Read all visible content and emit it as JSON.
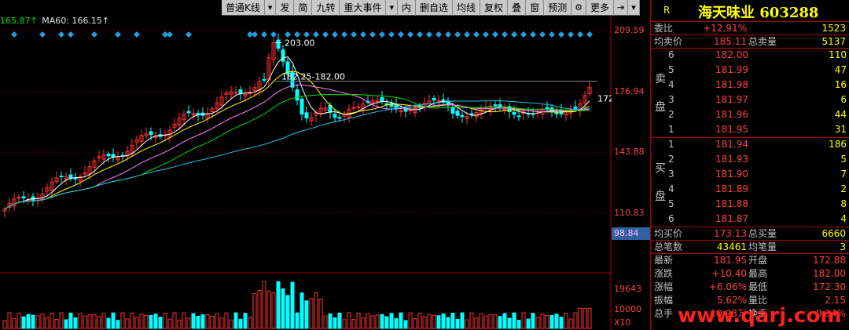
{
  "toolbar": {
    "items": [
      "普通K线",
      "发",
      "简",
      "九转",
      "重大事件",
      "内",
      "删自选",
      "均线",
      "复权",
      "叠",
      "窗",
      "预测",
      "更多"
    ],
    "icons": [
      "dropdown-icon",
      "dropdown-icon",
      "settings-icon",
      "dock-icon",
      "dropdown-icon"
    ]
  },
  "ma_legend": {
    "ma_prev": "165.87↑",
    "ma60": "MA60: 166.15↑"
  },
  "price_axis": {
    "labels": [
      "209.59",
      "176.94",
      "143.88",
      "110.83"
    ],
    "current_low": "98.84"
  },
  "annotations": {
    "high": "203.00",
    "range": "182.25-182.00",
    "right_price": "172"
  },
  "volume_axis": {
    "labels": [
      "19643",
      "10000"
    ],
    "unit": "X10"
  },
  "stock": {
    "r_label": "R",
    "title": "海天味业 603288"
  },
  "summary_top": {
    "weibi_label": "委比",
    "weibi_val": "+12.91%",
    "weibi_num": "1523",
    "avg_sell_label": "均卖价",
    "avg_sell_val": "185.11",
    "total_sell_label": "总卖量",
    "total_sell_val": "5137"
  },
  "sell_side": {
    "label": [
      "卖",
      "盘"
    ],
    "levels": [
      {
        "lvl": "6",
        "price": "182.00",
        "vol": "110"
      },
      {
        "lvl": "5",
        "price": "181.99",
        "vol": "47"
      },
      {
        "lvl": "4",
        "price": "181.98",
        "vol": "16"
      },
      {
        "lvl": "3",
        "price": "181.97",
        "vol": "6"
      },
      {
        "lvl": "2",
        "price": "181.96",
        "vol": "44"
      },
      {
        "lvl": "1",
        "price": "181.95",
        "vol": "31"
      }
    ]
  },
  "buy_side": {
    "label": [
      "买",
      "盘"
    ],
    "levels": [
      {
        "lvl": "1",
        "price": "181.94",
        "vol": "186"
      },
      {
        "lvl": "2",
        "price": "181.93",
        "vol": "5"
      },
      {
        "lvl": "3",
        "price": "181.90",
        "vol": "7"
      },
      {
        "lvl": "4",
        "price": "181.89",
        "vol": "2"
      },
      {
        "lvl": "5",
        "price": "181.88",
        "vol": "8"
      },
      {
        "lvl": "6",
        "price": "181.87",
        "vol": "4"
      }
    ]
  },
  "summary_mid": {
    "avg_buy_label": "均买价",
    "avg_buy_val": "173.13",
    "total_buy_label": "总买量",
    "total_buy_val": "6660",
    "trades_label": "总笔数",
    "trades_val": "43461",
    "avg_trade_label": "均笔量",
    "avg_trade_val": "3"
  },
  "quote": [
    {
      "l1": "最新",
      "v1": "181.95",
      "l2": "开盘",
      "v2": "172.88"
    },
    {
      "l1": "涨跌",
      "v1": "+10.40",
      "l2": "最高",
      "v2": "182.00"
    },
    {
      "l1": "涨幅",
      "v1": "+6.06%",
      "l2": "最低",
      "v2": "172.30"
    },
    {
      "l1": "振幅",
      "v1": "5.62%",
      "l2": "量比",
      "v2": "2.15"
    },
    {
      "l1": "总手",
      "v1": "10.93万",
      "l2": "换手",
      "v2": "0.34%"
    }
  ],
  "watermark": "www.qarj.com",
  "colors": {
    "up": "#ff3030",
    "down": "#00ffff",
    "ma5": "#ffffff",
    "ma10": "#ffff00",
    "ma20": "#ff80ff",
    "ma30": "#00e000",
    "ma60": "#20c0e0",
    "signal": "#20a0e0"
  }
}
